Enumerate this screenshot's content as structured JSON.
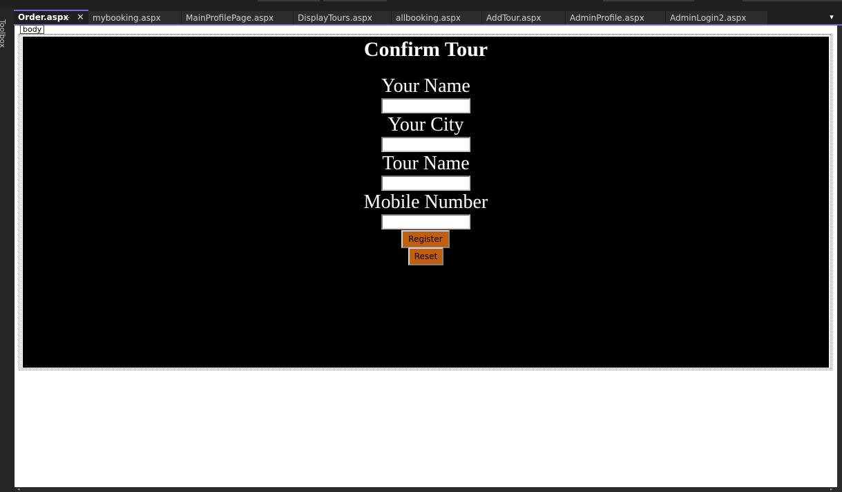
{
  "toolbox": {
    "label": "Toolbox"
  },
  "tabs": [
    {
      "label": "Order.aspx",
      "active": true
    },
    {
      "label": "mybooking.aspx"
    },
    {
      "label": "MainProfilePage.aspx"
    },
    {
      "label": "DisplayTours.aspx"
    },
    {
      "label": "allbooking.aspx"
    },
    {
      "label": "AddTour.aspx"
    },
    {
      "label": "AdminProfile.aspx"
    },
    {
      "label": "AdminLogin2.aspx"
    }
  ],
  "icons": {
    "pin": "⊹",
    "close": "✕",
    "overflow": "▾"
  },
  "design": {
    "body_tag": "body"
  },
  "form": {
    "title": "Confirm Tour",
    "fields": [
      {
        "label": "Your Name",
        "value": ""
      },
      {
        "label": "Your City",
        "value": ""
      },
      {
        "label": "Tour Name",
        "value": ""
      },
      {
        "label": "Mobile Number",
        "value": ""
      }
    ],
    "register_label": "Register",
    "reset_label": "Reset"
  },
  "colors": {
    "accent": "#7c6ad8",
    "panel_bg": "#000000",
    "button_bg": "#c15f0e"
  }
}
